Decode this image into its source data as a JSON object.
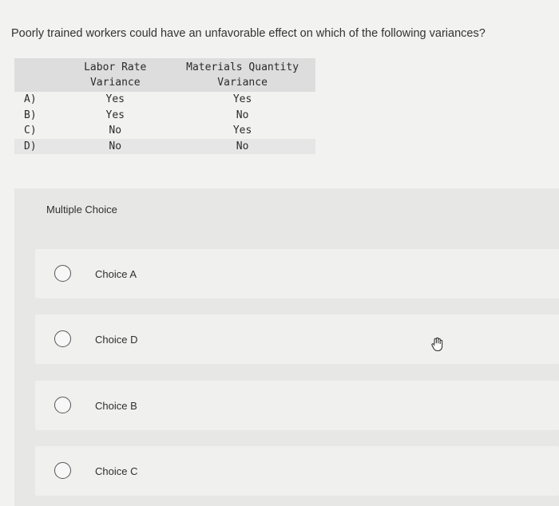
{
  "question": "Poorly trained workers could have an unfavorable effect on which of the following variances?",
  "table": {
    "headers": [
      "Labor Rate Variance",
      "Materials Quantity Variance"
    ],
    "header_lines": [
      [
        "Labor Rate",
        "Variance"
      ],
      [
        "Materials Quantity",
        "Variance"
      ]
    ],
    "rows": [
      {
        "letter": "A)",
        "labor": "Yes",
        "materials": "Yes"
      },
      {
        "letter": "B)",
        "labor": "Yes",
        "materials": "No"
      },
      {
        "letter": "C)",
        "labor": "No",
        "materials": "Yes"
      },
      {
        "letter": "D)",
        "labor": "No",
        "materials": "No"
      }
    ]
  },
  "multiple_choice": {
    "header": "Multiple Choice",
    "choices": [
      {
        "label": "Choice A",
        "selected": false
      },
      {
        "label": "Choice D",
        "selected": false
      },
      {
        "label": "Choice B",
        "selected": false
      },
      {
        "label": "Choice C",
        "selected": false
      }
    ]
  },
  "cursor_icon": "hand-pointer-icon"
}
